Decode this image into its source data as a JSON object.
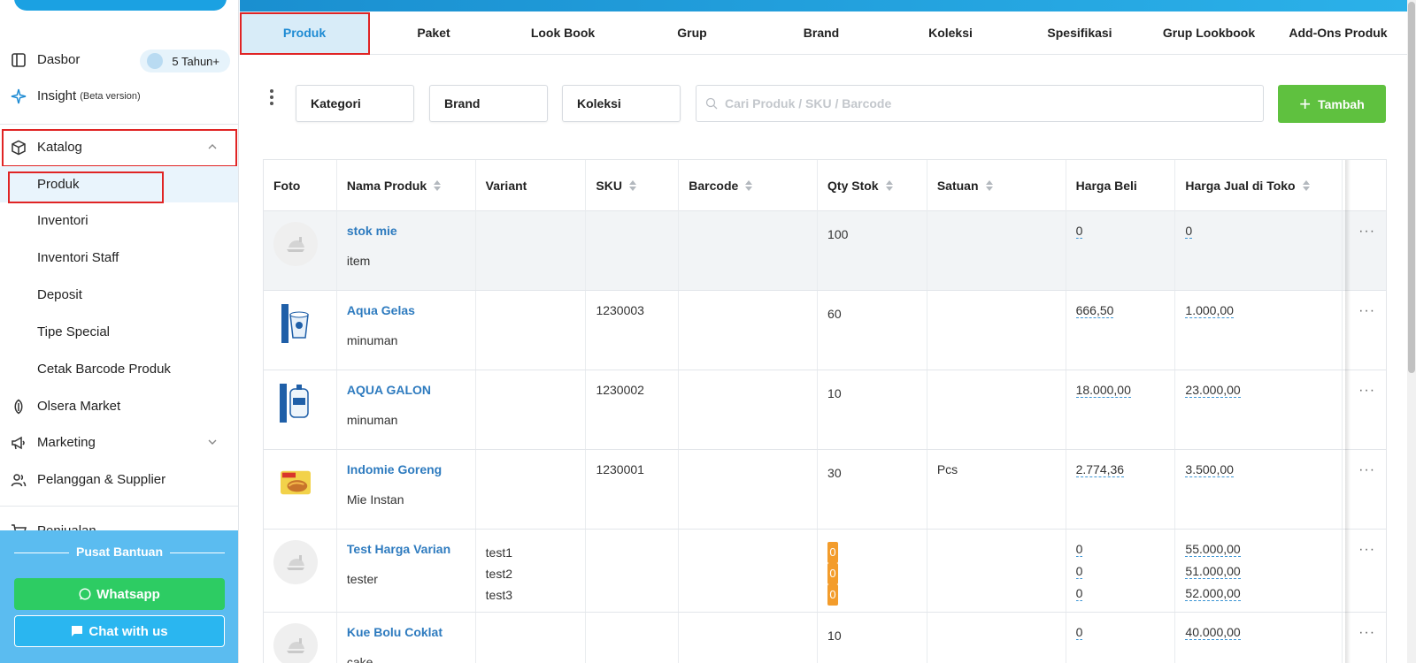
{
  "sidebar": {
    "items": [
      {
        "label": "Dasbor"
      },
      {
        "label": "Insight",
        "note": "(Beta version)"
      },
      {
        "label": "Katalog"
      },
      {
        "label": "Produk"
      },
      {
        "label": "Inventori"
      },
      {
        "label": "Inventori Staff"
      },
      {
        "label": "Deposit"
      },
      {
        "label": "Tipe Special"
      },
      {
        "label": "Cetak Barcode Produk"
      },
      {
        "label": "Olsera Market"
      },
      {
        "label": "Marketing"
      },
      {
        "label": "Pelanggan & Supplier"
      },
      {
        "label": "Penjualan"
      }
    ],
    "badge": "5 Tahun+",
    "help": {
      "title": "Pusat Bantuan",
      "whatsapp": "Whatsapp",
      "chat": "Chat with us"
    }
  },
  "tabs": [
    "Produk",
    "Paket",
    "Look Book",
    "Grup",
    "Brand",
    "Koleksi",
    "Spesifikasi",
    "Grup Lookbook",
    "Add-Ons Produk"
  ],
  "filters": {
    "kategori": "Kategori",
    "brand": "Brand",
    "koleksi": "Koleksi",
    "search_placeholder": "Cari Produk / SKU / Barcode",
    "add_label": "Tambah"
  },
  "table": {
    "headers": [
      "Foto",
      "Nama Produk",
      "Variant",
      "SKU",
      "Barcode",
      "Qty Stok",
      "Satuan",
      "Harga Beli",
      "Harga Jual di Toko"
    ],
    "rows": [
      {
        "name": "stok mie",
        "category": "item",
        "variant": [],
        "sku": "",
        "barcode": "",
        "qty": [
          "100"
        ],
        "satuan": "",
        "harga_beli": [
          "0"
        ],
        "harga_jual": [
          "0"
        ]
      },
      {
        "name": "Aqua Gelas",
        "category": "minuman",
        "variant": [],
        "sku": "1230003",
        "barcode": "",
        "qty": [
          "60"
        ],
        "satuan": "",
        "harga_beli": [
          "666,50"
        ],
        "harga_jual": [
          "1.000,00"
        ]
      },
      {
        "name": "AQUA GALON",
        "category": "minuman",
        "variant": [],
        "sku": "1230002",
        "barcode": "",
        "qty": [
          "10"
        ],
        "satuan": "",
        "harga_beli": [
          "18.000,00"
        ],
        "harga_jual": [
          "23.000,00"
        ]
      },
      {
        "name": "Indomie Goreng",
        "category": "Mie Instan",
        "variant": [],
        "sku": "1230001",
        "barcode": "",
        "qty": [
          "30"
        ],
        "satuan": "Pcs",
        "harga_beli": [
          "2.774,36"
        ],
        "harga_jual": [
          "3.500,00"
        ]
      },
      {
        "name": "Test Harga Varian",
        "category": "tester",
        "variant": [
          "test1",
          "test2",
          "test3"
        ],
        "sku": "",
        "barcode": "",
        "qty": [
          "0",
          "0",
          "0"
        ],
        "satuan": "",
        "harga_beli": [
          "0",
          "0",
          "0"
        ],
        "harga_jual": [
          "55.000,00",
          "51.000,00",
          "52.000,00"
        ]
      },
      {
        "name": "Kue Bolu Coklat",
        "category": "cake",
        "variant": [],
        "sku": "",
        "barcode": "",
        "qty": [
          "10"
        ],
        "satuan": "",
        "harga_beli": [
          "0"
        ],
        "harga_jual": [
          "40.000,00"
        ]
      }
    ],
    "row_menu": "···"
  }
}
